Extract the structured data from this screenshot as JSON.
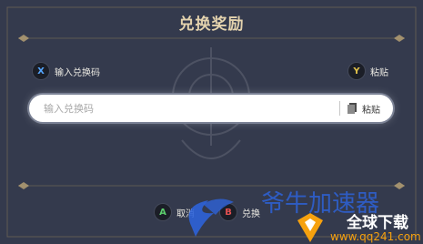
{
  "dialog": {
    "title": "兑换奖励",
    "hint_left": {
      "button": "X",
      "label": "输入兑换码"
    },
    "hint_right": {
      "button": "Y",
      "label": "粘贴"
    },
    "input": {
      "placeholder": "输入兑换码",
      "value": ""
    },
    "paste": {
      "label": "粘贴",
      "icon": "clipboard-icon"
    },
    "actions": [
      {
        "button": "A",
        "label": "取消"
      },
      {
        "button": "B",
        "label": "兑换"
      }
    ]
  },
  "watermark": {
    "brand": "爷牛加速器",
    "right_text": "全球下载",
    "url": "www.qq241.com"
  },
  "colors": {
    "background": "#343a4d",
    "title": "#e3d2ad",
    "x": "#56a7ff",
    "y": "#e0c14a",
    "a": "#5ccf6d",
    "b": "#e35050",
    "watermark_blue": "#2e63d8",
    "watermark_orange": "#f6a10e"
  }
}
